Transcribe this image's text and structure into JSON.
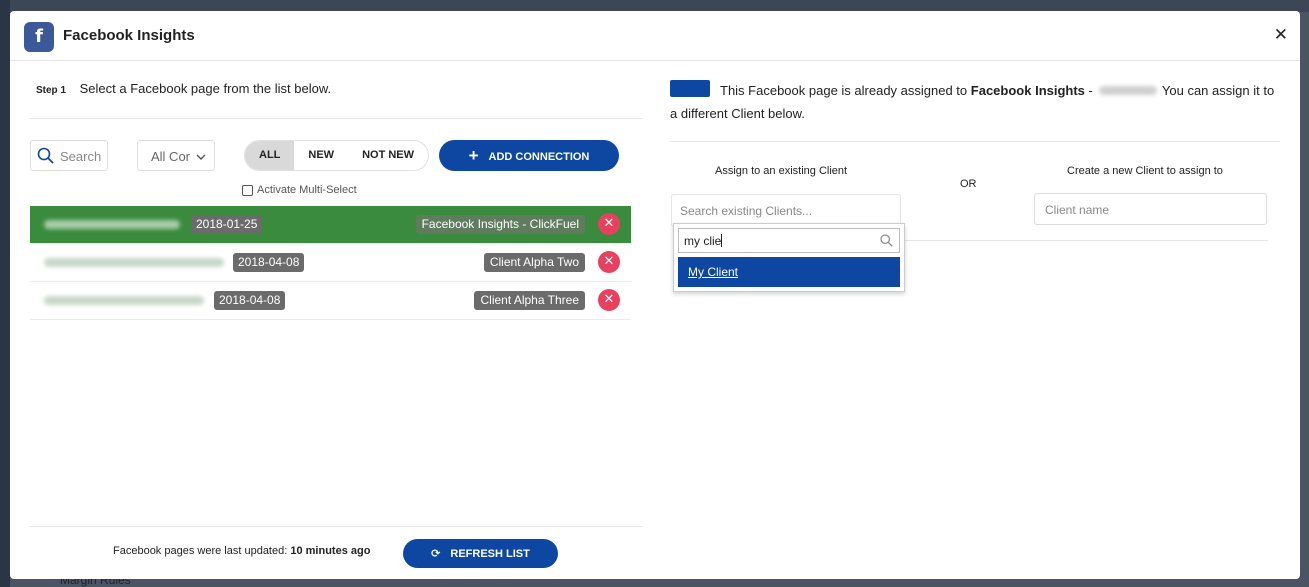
{
  "background": {
    "partial_text": "Margin Rules"
  },
  "modal": {
    "logo_letter": "f",
    "title": "Facebook Insights",
    "close_symbol": "✕"
  },
  "step1": {
    "label": "Step 1",
    "text": "Select a Facebook page from the list below."
  },
  "filters": {
    "search_placeholder": "Search",
    "select_value": "All Cor",
    "toggle_options": [
      "ALL",
      "NEW",
      "NOT NEW"
    ],
    "active_toggle": "ALL",
    "add_connection_label": "ADD CONNECTION",
    "multi_select_label": "Activate Multi-Select"
  },
  "pages": [
    {
      "date": "2018-01-25",
      "client": "Facebook Insights - ClickFuel",
      "selected": true
    },
    {
      "date": "2018-04-08",
      "client": "Client Alpha Two",
      "selected": false
    },
    {
      "date": "2018-04-08",
      "client": "Client Alpha Three",
      "selected": false
    }
  ],
  "footer": {
    "last_updated_prefix": "Facebook pages were last updated:",
    "last_updated_value": "10 minutes ago",
    "refresh_label": "REFRESH LIST"
  },
  "step2": {
    "text_before": "This Facebook page is already assigned to",
    "assigned_to": "Facebook Insights",
    "dash": "-",
    "text_after": "You can assign it to a different Client below."
  },
  "assign": {
    "existing_label": "Assign to an existing Client",
    "or_label": "OR",
    "create_label": "Create a new Client to assign to",
    "existing_placeholder": "Search existing Clients...",
    "client_name_placeholder": "Client name",
    "dropdown_query": "my clie",
    "dropdown_option": "My Client"
  },
  "colors": {
    "primary": "#0d47a1",
    "selected_row": "#3a8b3e",
    "remove": "#e8415f",
    "facebook": "#3b5998"
  }
}
